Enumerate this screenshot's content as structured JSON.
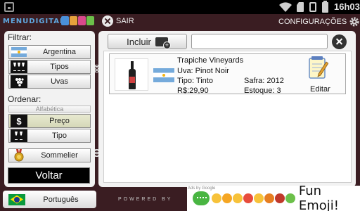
{
  "status_bar": {
    "time": "16h03"
  },
  "header": {
    "logo": "MENUDIGITAL",
    "exit_label": "SAIR",
    "config_label": "CONFIGURAÇÕES",
    "logo_icon_colors": [
      "#4a90d9",
      "#e6a23c",
      "#d94a8c",
      "#6cc04a"
    ]
  },
  "filter": {
    "title": "Filtrar:",
    "items": [
      {
        "label": "Argentina",
        "icon": "argentina-flag-icon"
      },
      {
        "label": "Tipos",
        "icon": "wine-glasses-icon"
      },
      {
        "label": "Uvas",
        "icon": "grapes-icon"
      }
    ]
  },
  "sort": {
    "title": "Ordenar:",
    "partial_label": "Alfabética",
    "items": [
      {
        "label": "Preço",
        "icon": "dollar-icon",
        "selected": true
      },
      {
        "label": "Tipo",
        "icon": "wine-glasses-icon",
        "selected": false
      }
    ]
  },
  "sommelier_label": "Sommelier",
  "back_label": "Voltar",
  "language_label": "Português",
  "main": {
    "add_label": "Incluir",
    "search_value": ""
  },
  "wine": {
    "name": "Trapiche Vineyards",
    "grape": "Uva:   Pinot Noir",
    "type": "Tipo: Tinto",
    "harvest": "Safra: 2012",
    "price": "R$:29,90",
    "stock": "Estoque: 3",
    "edit_label": "Editar"
  },
  "footer": {
    "powered": "POWERED BY",
    "ad_title": "Fun Emoji!",
    "ad_badge": "Ads by Google"
  }
}
